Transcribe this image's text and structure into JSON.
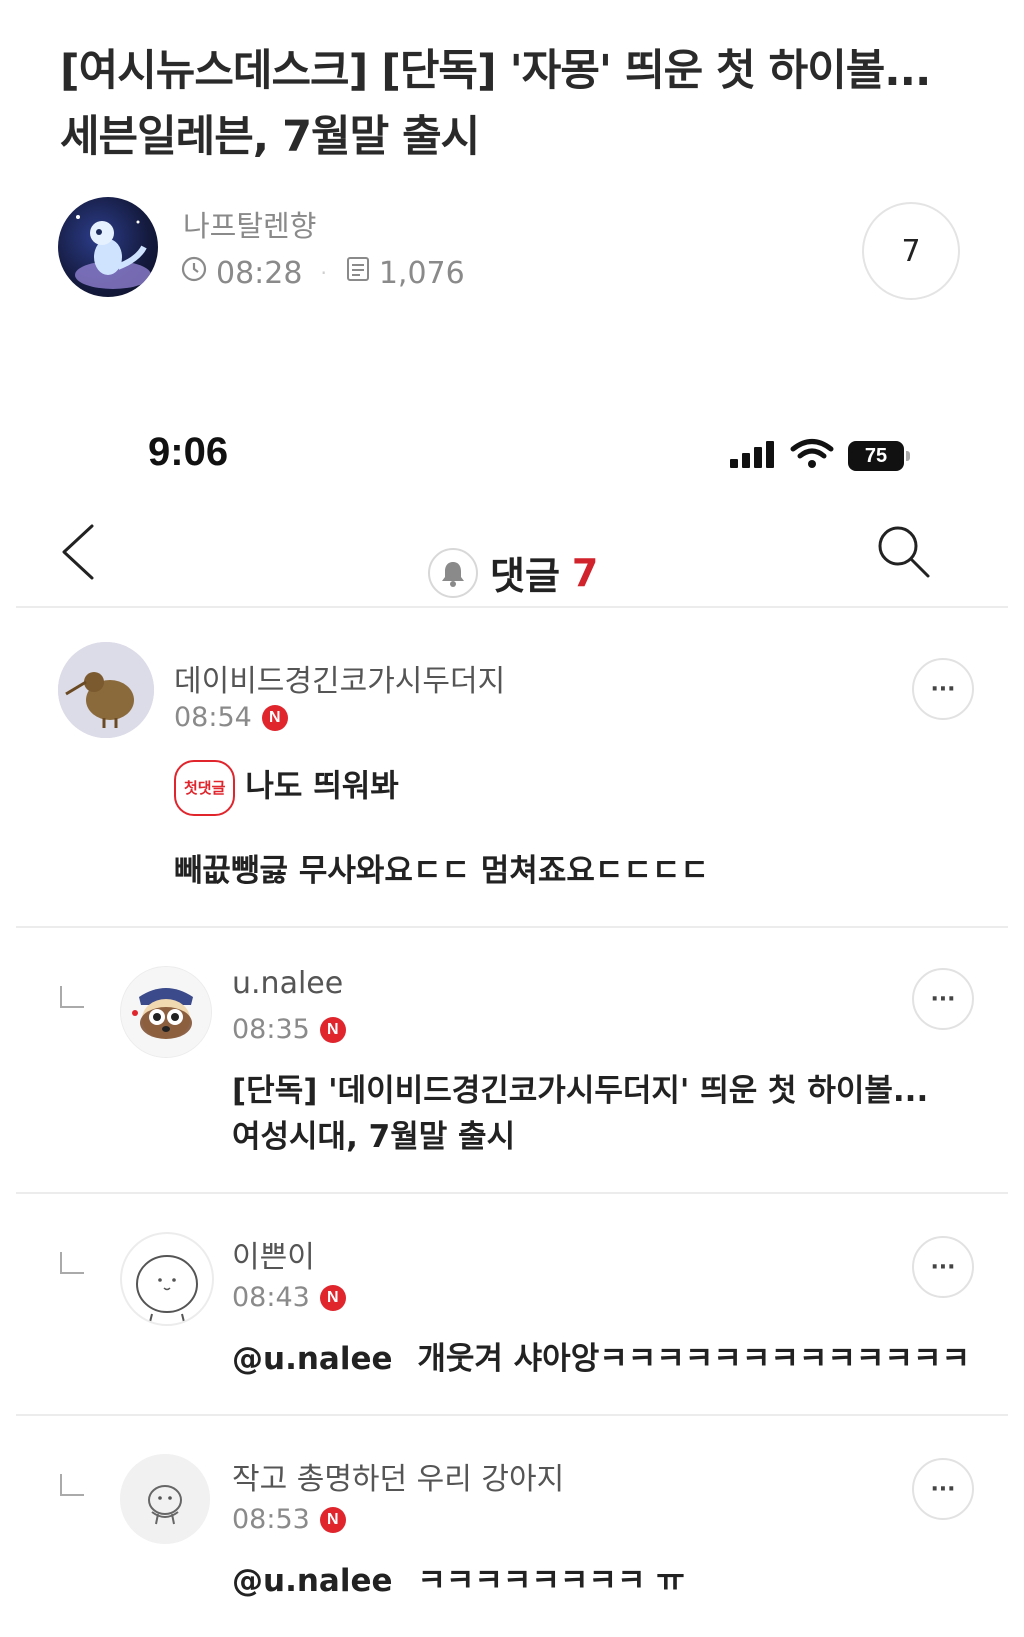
{
  "post": {
    "title_line1": "[여시뉴스데스크] [단독] '자몽' 띄운 첫 하이볼...",
    "title_line2": "세븐일레븐, 7월말 출시",
    "author": "나프탈렌향",
    "time": "08:28",
    "views": "1,076",
    "comment_count": "7"
  },
  "status_bar": {
    "time": "9:06",
    "battery": "75"
  },
  "nav": {
    "title": "댓글",
    "count": "7"
  },
  "comments": [
    {
      "username": "데이비드경긴코가시두더지",
      "time": "08:54",
      "badge_n": "N",
      "first_badge": "첫댓글",
      "line1": "나도 띄워봐",
      "line2": "빼끖뺑긇 무사와요ㄷㄷ 멈쳐죠요ㄷㄷㄷㄷ",
      "more": "···"
    },
    {
      "username": "u.nalee",
      "time": "08:35",
      "badge_n": "N",
      "line1": "[단독] '데이비드경긴코가시두더지' 띄운 첫 하이볼...",
      "line2": "여성시대, 7월말 출시",
      "more": "···"
    },
    {
      "username": "이쁜이",
      "time": "08:43",
      "badge_n": "N",
      "mention": "@u.nalee",
      "text": "개웃겨 샤아앙ㅋㅋㅋㅋㅋㅋㅋㅋㅋㅋㅋㅋㅋ",
      "more": "···"
    },
    {
      "username": "작고 총명하던 우리 강아지",
      "time": "08:53",
      "badge_n": "N",
      "mention": "@u.nalee",
      "text": "ㅋㅋㅋㅋㅋㅋㅋㅋ ㅠ",
      "more": "···"
    }
  ],
  "colors": {
    "accent_red": "#d0232b",
    "meta_gray": "#8a8a8a",
    "divider": "#ececec"
  }
}
